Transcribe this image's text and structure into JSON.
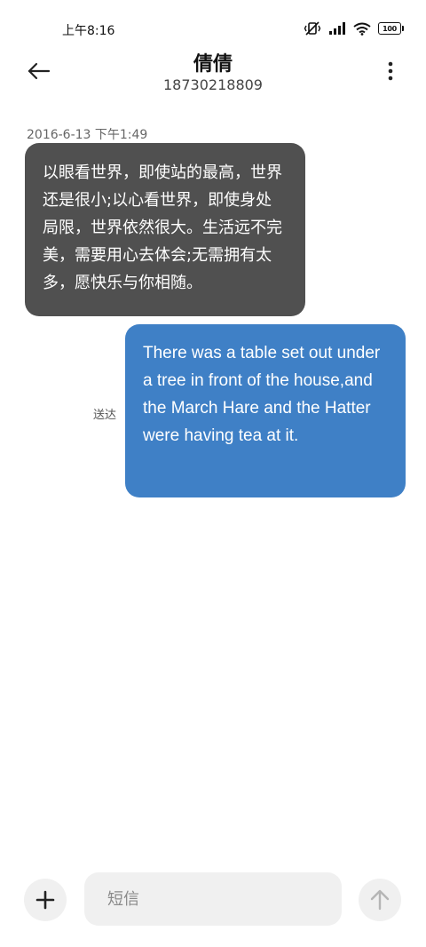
{
  "status_bar": {
    "time": "上午8:16",
    "battery_level": "100",
    "icons": [
      "vibrate-muted-icon",
      "signal-icon",
      "wifi-icon",
      "battery-icon"
    ]
  },
  "header": {
    "contact_name": "倩倩",
    "phone_number": "18730218809",
    "back_icon": "arrow-left-icon",
    "more_icon": "more-vertical-icon"
  },
  "conversation": {
    "timestamp": "2016-6-13 下午1:49",
    "messages": [
      {
        "direction": "incoming",
        "text": "以眼看世界，即使站的最高，世界还是很小;以心看世界，即使身处局限，世界依然很大。生活远不完美，需要用心去体会;无需拥有太多，愿快乐与你相随。"
      },
      {
        "direction": "outgoing",
        "text": "There was a table set out under a tree in front of the house,and the March Hare and the Hatter were having tea at it.",
        "status": "送达"
      }
    ]
  },
  "composer": {
    "placeholder": "短信",
    "value": "",
    "add_icon": "plus-icon",
    "send_icon": "arrow-up-icon"
  },
  "colors": {
    "incoming_bubble": "#505050",
    "outgoing_bubble": "#3f80c6",
    "composer_background": "#f0f0f0"
  }
}
